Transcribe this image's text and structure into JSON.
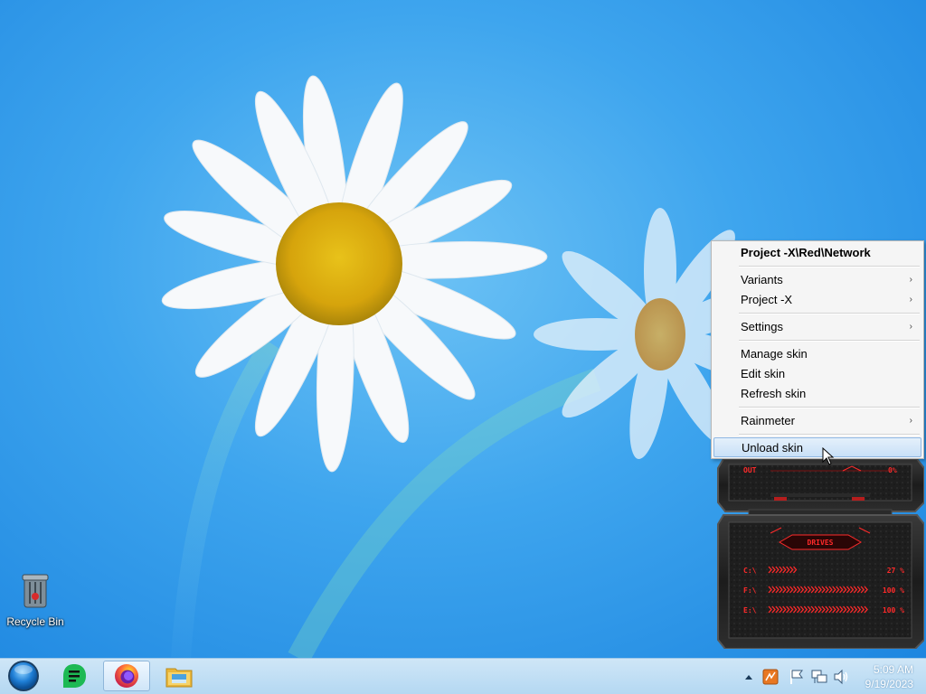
{
  "desktop": {
    "icons": [
      {
        "label": "Recycle Bin",
        "icon": "recycle-bin-icon"
      }
    ]
  },
  "context_menu": {
    "title": "Project -X\\Red\\Network",
    "items": [
      {
        "label": "Variants",
        "submenu": true
      },
      {
        "label": "Project -X",
        "submenu": true
      },
      {
        "label": "Settings",
        "submenu": true
      },
      {
        "label": "Manage skin",
        "submenu": false
      },
      {
        "label": "Edit skin",
        "submenu": false
      },
      {
        "label": "Refresh skin",
        "submenu": false
      },
      {
        "label": "Rainmeter",
        "submenu": true
      },
      {
        "label": "Unload skin",
        "submenu": false,
        "highlighted": true
      }
    ],
    "submenu_arrow": "›"
  },
  "skin_widget": {
    "network": {
      "label": "OUT",
      "value": "0%"
    },
    "drives": {
      "title": "DRIVES",
      "rows": [
        {
          "label": "C:\\",
          "value": "27 %",
          "fill": 0.27
        },
        {
          "label": "F:\\",
          "value": "100 %",
          "fill": 1.0
        },
        {
          "label": "E:\\",
          "value": "100 %",
          "fill": 1.0
        }
      ]
    },
    "accent": "#ff2a2a"
  },
  "taskbar": {
    "start": "start-orb-icon",
    "pinned": [
      {
        "name": "notes-app-icon",
        "active": false
      },
      {
        "name": "firefox-icon",
        "active": true
      },
      {
        "name": "file-explorer-icon",
        "active": false
      }
    ],
    "tray": [
      "show-hidden-icons-icon",
      "rainmeter-tray-icon",
      "action-center-flag-icon",
      "network-icon",
      "volume-icon"
    ],
    "clock": {
      "time": "5:09 AM",
      "date": "9/19/2023"
    }
  }
}
